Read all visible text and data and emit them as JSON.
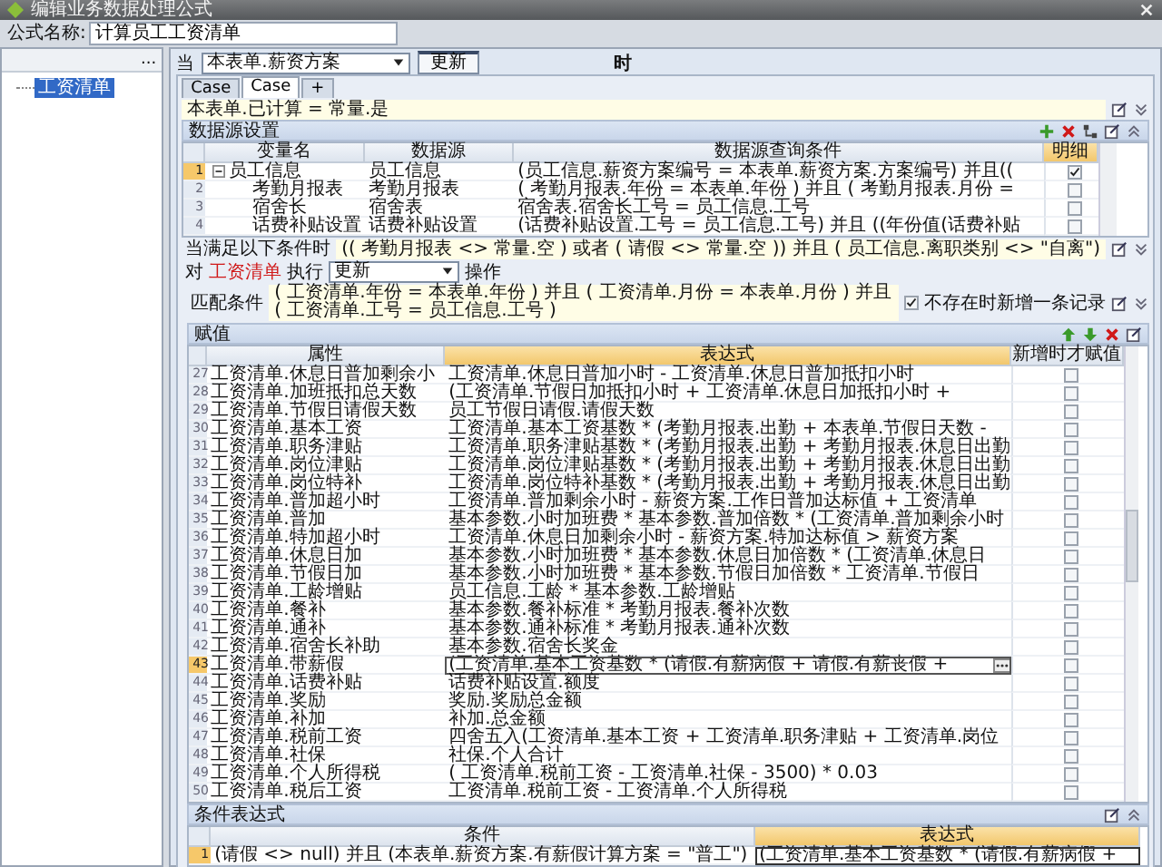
{
  "window": {
    "title": "编辑业务数据处理公式"
  },
  "formula_name": {
    "label": "公式名称:",
    "value": "计算员工工资清单"
  },
  "tree": {
    "button": "...",
    "items": [
      {
        "label": "工资清单",
        "selected": true
      }
    ]
  },
  "trigger": {
    "prefix": "当",
    "field": "本表单.薪资方案",
    "action": "更新",
    "suffix": "时"
  },
  "tabs": [
    {
      "label": "Case",
      "selected": false
    },
    {
      "label": "Case",
      "selected": true
    },
    {
      "label": "+",
      "selected": false
    }
  ],
  "case_condition": "本表单.已计算 = 常量.是",
  "data_sources": {
    "title": "数据源设置",
    "columns": [
      "变量名",
      "数据源",
      "数据源查询条件",
      "明细"
    ],
    "rows": [
      {
        "num": "1",
        "name": "员工信息",
        "source": "员工信息",
        "query": "(员工信息.薪资方案编号 = 本表单.薪资方案.方案编号) 并且((",
        "detail": true,
        "expanded": true,
        "children": [
          {
            "num": "2",
            "name": "考勤月报表",
            "source": "考勤月报表",
            "query": "( 考勤月报表.年份 = 本表单.年份 ) 并且 ( 考勤月报表.月份 =",
            "detail": false
          },
          {
            "num": "3",
            "name": "宿舍长",
            "source": "宿舍表",
            "query": "宿舍表.宿舍长工号 = 员工信息.工号",
            "detail": false
          },
          {
            "num": "4",
            "name": "话费补贴设置",
            "source": "话费补贴设置",
            "query": "(话费补贴设置.工号 = 员工信息.工号) 并且 ((年份值(话费补贴",
            "detail": false
          }
        ]
      }
    ]
  },
  "when": {
    "label": "当满足以下条件时",
    "value": "(( 考勤月报表 <> 常量.空 ) 或者 ( 请假 <> 常量.空 )) 并且 ( 员工信息.离职类别 <> \"自离\")"
  },
  "operation": {
    "prefix": "对",
    "target": "工资清单",
    "verb": "执行",
    "mode": "更新",
    "suffix": "操作"
  },
  "match": {
    "label": "匹配条件",
    "value": "( 工资清单.年份 = 本表单.年份 ) 并且 ( 工资清单.月份 = 本表单.月份 ) 并且 ( 工资清单.工号 = 员工信息.工号 )",
    "insert_if_missing": {
      "label": "不存在时新增一条记录",
      "checked": true
    }
  },
  "assign": {
    "title": "赋值",
    "columns": [
      "属性",
      "表达式",
      "新增时才赋值"
    ],
    "rows": [
      {
        "num": "27",
        "field": "工资清单.休息日普加剩余小",
        "expr": "工资清单.休息日普加小时 - 工资清单.休息日普加抵扣小时",
        "insert_only": false,
        "selected": false
      },
      {
        "num": "28",
        "field": "工资清单.加班抵扣总天数",
        "expr": "(工资清单.节假日加抵扣小时 + 工资清单.休息日加抵扣小时 +",
        "insert_only": false,
        "selected": false
      },
      {
        "num": "29",
        "field": "工资清单.节假日请假天数",
        "expr": "员工节假日请假.请假天数",
        "insert_only": false,
        "selected": false
      },
      {
        "num": "30",
        "field": "工资清单.基本工资",
        "expr": "工资清单.基本工资基数 * (考勤月报表.出勤 + 本表单.节假日天数 -",
        "insert_only": false,
        "selected": false
      },
      {
        "num": "31",
        "field": "工资清单.职务津贴",
        "expr": "工资清单.职务津贴基数 * (考勤月报表.出勤 + 考勤月报表.休息日出勤",
        "insert_only": false,
        "selected": false
      },
      {
        "num": "32",
        "field": "工资清单.岗位津贴",
        "expr": "工资清单.岗位津贴基数 * (考勤月报表.出勤 + 考勤月报表.休息日出勤",
        "insert_only": false,
        "selected": false
      },
      {
        "num": "33",
        "field": "工资清单.岗位特补",
        "expr": "工资清单.岗位特补基数 * (考勤月报表.出勤 + 考勤月报表.休息日出勤",
        "insert_only": false,
        "selected": false
      },
      {
        "num": "34",
        "field": "工资清单.普加超小时",
        "expr": "工资清单.普加剩余小时 - 薪资方案.工作日普加达标值 + 工资清单",
        "insert_only": false,
        "selected": false
      },
      {
        "num": "35",
        "field": "工资清单.普加",
        "expr": "基本参数.小时加班费 * 基本参数.普加倍数 * (工资清单.普加剩余小时",
        "insert_only": false,
        "selected": false
      },
      {
        "num": "36",
        "field": "工资清单.特加超小时",
        "expr": "工资清单.休息日加剩余小时 - 薪资方案.特加达标值 > 薪资方案",
        "insert_only": false,
        "selected": false
      },
      {
        "num": "37",
        "field": "工资清单.休息日加",
        "expr": "基本参数.小时加班费 * 基本参数.休息日加倍数 * (工资清单.休息日",
        "insert_only": false,
        "selected": false
      },
      {
        "num": "38",
        "field": "工资清单.节假日加",
        "expr": "基本参数.小时加班费 * 基本参数.节假日加倍数 * 工资清单.节假日",
        "insert_only": false,
        "selected": false
      },
      {
        "num": "39",
        "field": "工资清单.工龄增贴",
        "expr": "员工信息.工龄 * 基本参数.工龄增贴",
        "insert_only": false,
        "selected": false
      },
      {
        "num": "40",
        "field": "工资清单.餐补",
        "expr": "基本参数.餐补标准 * 考勤月报表.餐补次数",
        "insert_only": false,
        "selected": false
      },
      {
        "num": "41",
        "field": "工资清单.通补",
        "expr": "基本参数.通补标准 * 考勤月报表.通补次数",
        "insert_only": false,
        "selected": false
      },
      {
        "num": "42",
        "field": "工资清单.宿舍长补助",
        "expr": "基本参数.宿舍长奖金",
        "insert_only": false,
        "selected": false
      },
      {
        "num": "43",
        "field": "工资清单.带薪假",
        "expr": "(工资清单.基本工资基数 * (请假.有薪病假 + 请假.有薪丧假 +",
        "insert_only": false,
        "selected": true
      },
      {
        "num": "44",
        "field": "工资清单.话费补贴",
        "expr": "话费补贴设置.额度",
        "insert_only": false,
        "selected": false
      },
      {
        "num": "45",
        "field": "工资清单.奖励",
        "expr": "奖励.奖励总金额",
        "insert_only": false,
        "selected": false
      },
      {
        "num": "46",
        "field": "工资清单.补加",
        "expr": "补加.总金额",
        "insert_only": false,
        "selected": false
      },
      {
        "num": "47",
        "field": "工资清单.税前工资",
        "expr": "四舍五入(工资清单.基本工资 + 工资清单.职务津贴 + 工资清单.岗位",
        "insert_only": false,
        "selected": false
      },
      {
        "num": "48",
        "field": "工资清单.社保",
        "expr": "社保.个人合计",
        "insert_only": false,
        "selected": false
      },
      {
        "num": "49",
        "field": "工资清单.个人所得税",
        "expr": "( 工资清单.税前工资 - 工资清单.社保 - 3500) * 0.03",
        "insert_only": false,
        "selected": false
      },
      {
        "num": "50",
        "field": "工资清单.税后工资",
        "expr": "工资清单.税前工资 - 工资清单.个人所得税",
        "insert_only": false,
        "selected": false
      }
    ]
  },
  "cond_expr": {
    "title": "条件表达式",
    "columns": [
      "条件",
      "表达式"
    ],
    "rows": [
      {
        "num": "1",
        "cond": "(请假 <> null) 并且 (本表单.薪资方案.有薪假计算方案 = \"普工\")",
        "expr": "(工资清单.基本工资基数 * (请假.有薪病假 +",
        "selected": true
      }
    ]
  }
}
